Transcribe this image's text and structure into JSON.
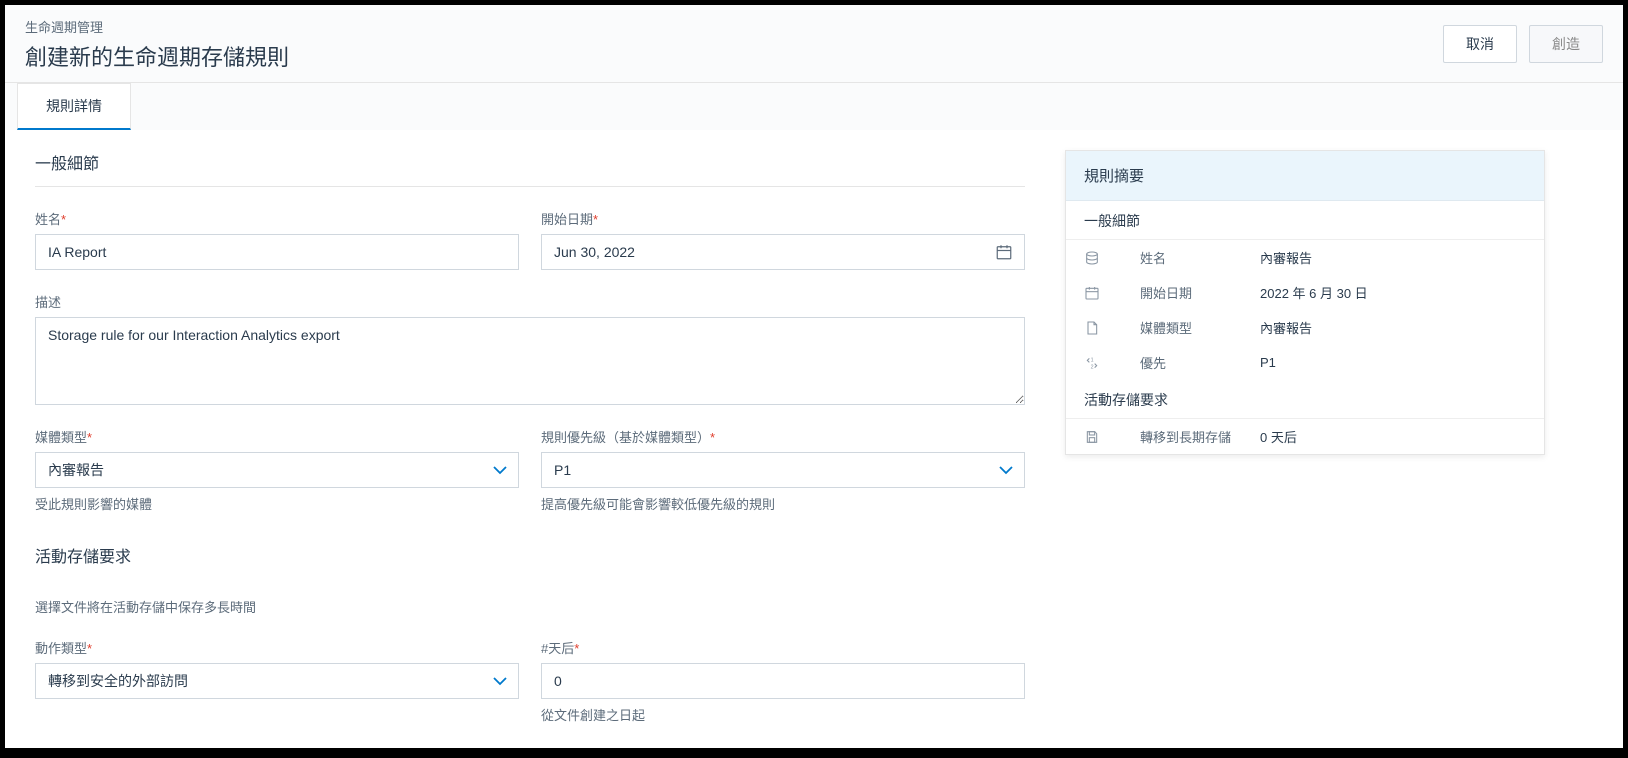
{
  "header": {
    "breadcrumb": "生命週期管理",
    "title": "創建新的生命週期存儲規則",
    "cancel_label": "取消",
    "create_label": "創造"
  },
  "tabs": {
    "details": "規則詳情"
  },
  "form": {
    "general": {
      "section_title": "一般細節",
      "name_label": "姓名",
      "name_value": "IA Report",
      "start_date_label": "開始日期",
      "start_date_value": "Jun 30, 2022",
      "description_label": "描述",
      "description_value": "Storage rule for our Interaction Analytics export",
      "media_type_label": "媒體類型",
      "media_type_value": "內審報告",
      "media_type_hint": "受此規則影響的媒體",
      "priority_label": "規則優先級（基於媒體類型）",
      "priority_value": "P1",
      "priority_hint": "提高優先級可能會影響較低優先級的規則"
    },
    "storage": {
      "section_title": "活動存儲要求",
      "sub_label": "選擇文件將在活動存儲中保存多長時間",
      "action_type_label": "動作類型",
      "action_type_value": "轉移到安全的外部訪問",
      "days_label": "#天后",
      "days_value": "0",
      "days_hint": "從文件創建之日起"
    }
  },
  "summary": {
    "title": "規則摘要",
    "general_label": "一般細節",
    "name_key": "姓名",
    "name_value": "內審報告",
    "start_date_key": "開始日期",
    "start_date_value": "2022 年 6 月 30 日",
    "media_type_key": "媒體類型",
    "media_type_value": "內審報告",
    "priority_key": "優先",
    "priority_value": "P1",
    "storage_label": "活動存儲要求",
    "transfer_key": "轉移到長期存儲",
    "transfer_value": "0 天后"
  }
}
